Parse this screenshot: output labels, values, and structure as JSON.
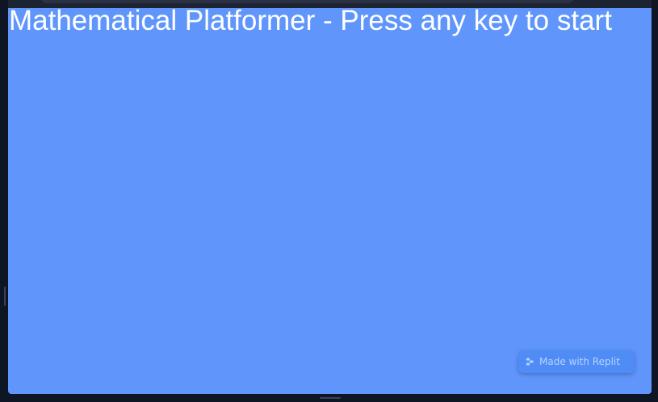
{
  "game": {
    "title": "Mathematical Platformer - Press any key to start",
    "background_color": "#6096fc"
  },
  "badge": {
    "label": "Made with Replit",
    "icon": "replit-logo-icon",
    "background_color": "#4f8cf5",
    "text_color": "#b7d2ff"
  },
  "chrome": {
    "frame_color": "#0e1525"
  }
}
